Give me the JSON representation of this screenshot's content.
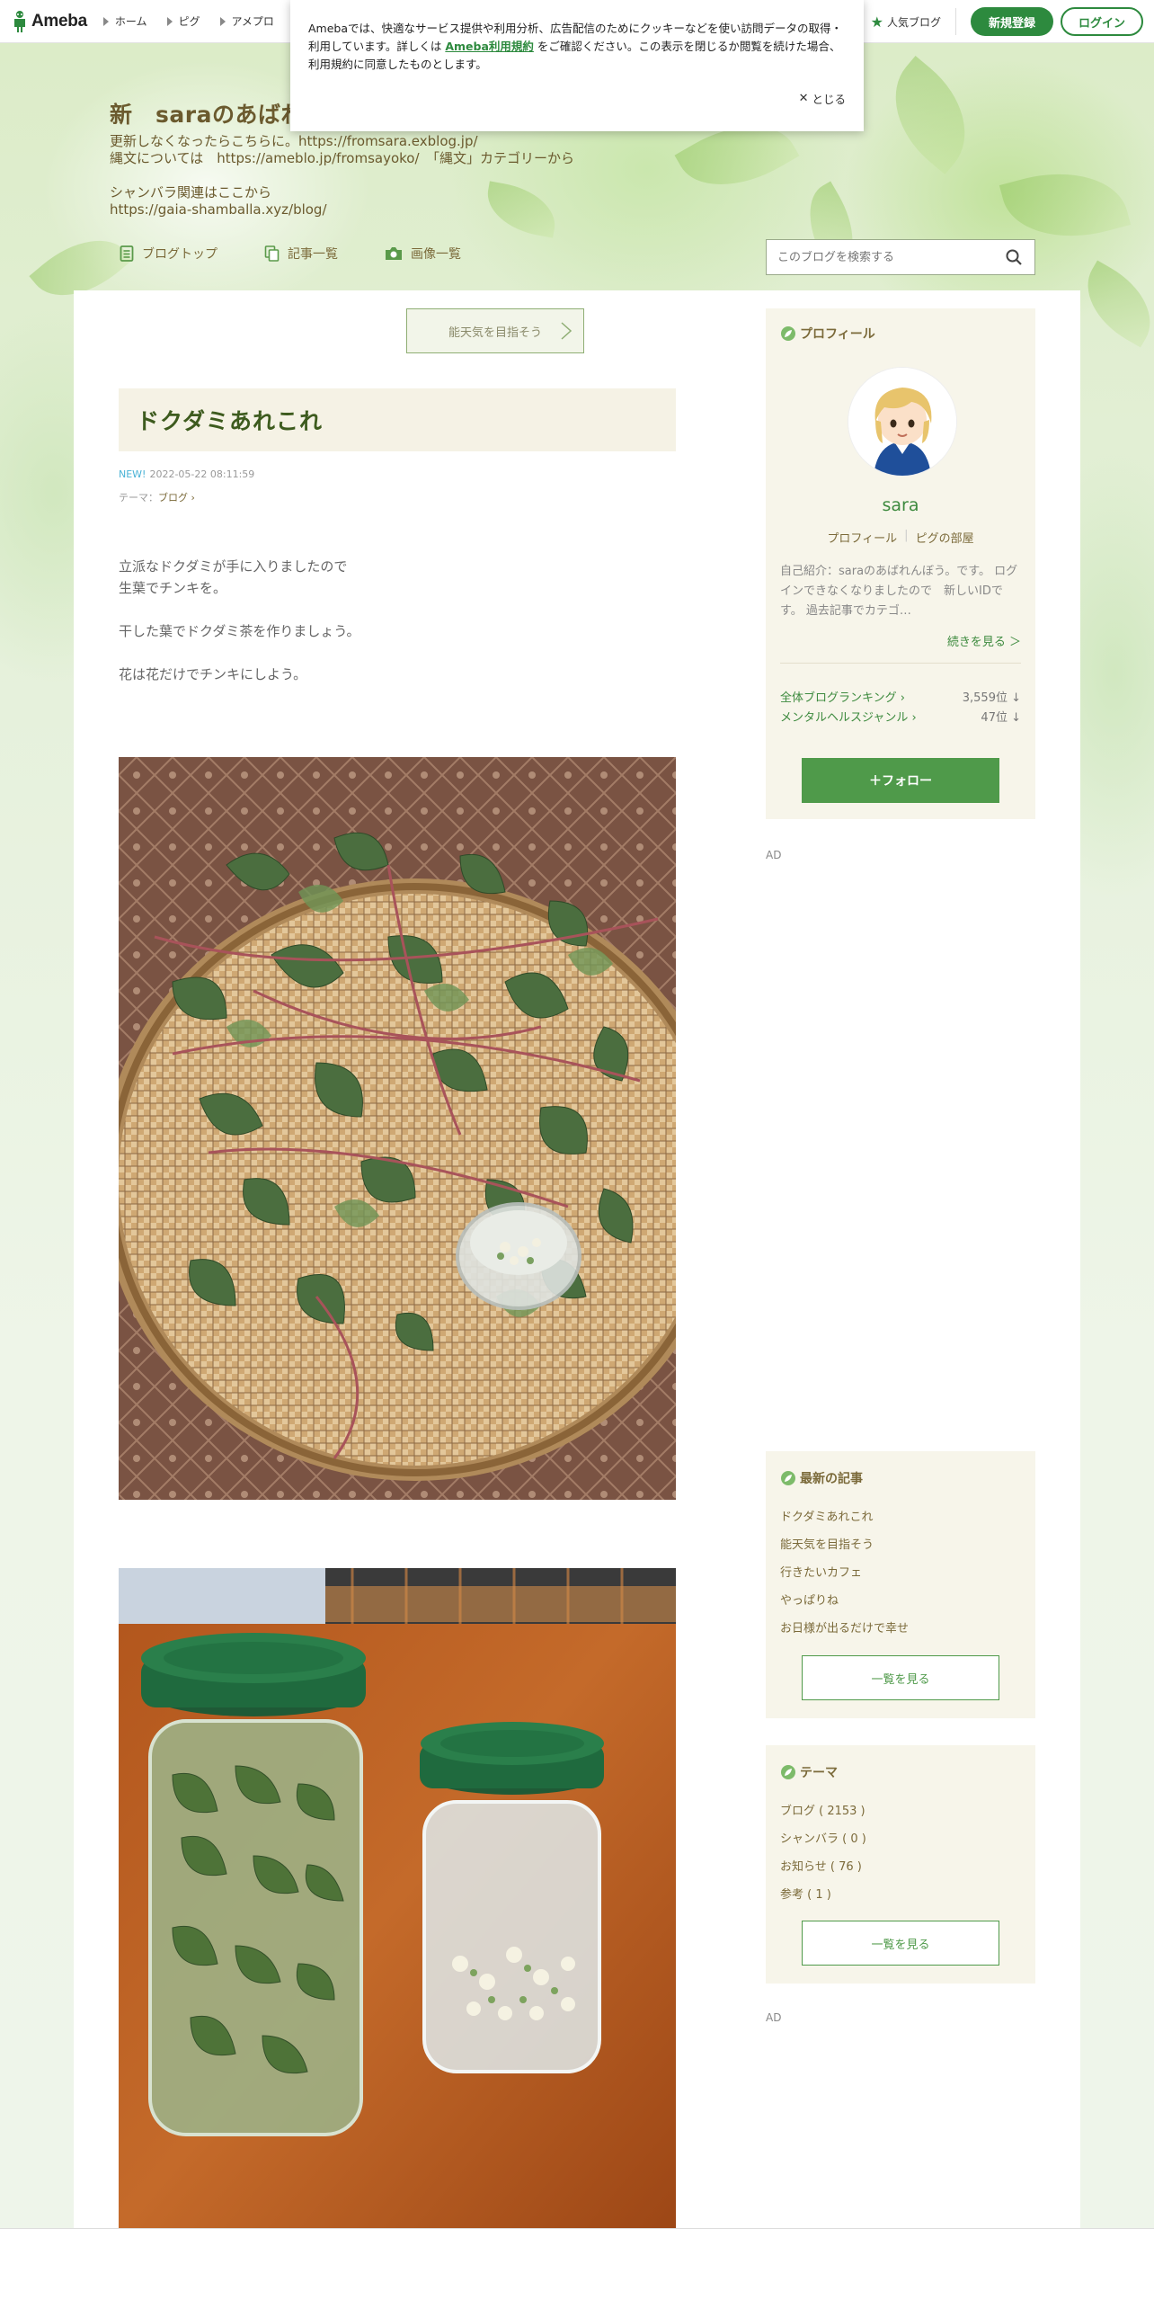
{
  "global_header": {
    "logo_text": "Ameba",
    "nav": [
      "ホーム",
      "ピグ",
      "アメプロ"
    ],
    "popular_blog": "人気ブログ",
    "signup": "新規登録",
    "login": "ログイン"
  },
  "cookie_notice": {
    "text_before": "Amebaでは、快適なサービス提供や利用分析、広告配信のためにクッキーなどを使い訪問データの取得・利用しています。詳しくは ",
    "link": "Ameba利用規約",
    "text_after": " をご確認ください。この表示を閉じるか閲覧を続けた場合、利用規約に同意したものとします。",
    "close": "とじる"
  },
  "blog": {
    "title": "新　saraのあばれんぼう。",
    "description": "更新しなくなったらこちらに。https://fromsara.exblog.jp/\n縄文については　https://ameblo.jp/fromsayoko/　「縄文」カテゴリーから\n\nシャンバラ関連はここから\nhttps://gaia-shamballa.xyz/blog/",
    "nav": {
      "top": "ブログトップ",
      "entries": "記事一覧",
      "images": "画像一覧"
    },
    "search_placeholder": "このブログを検索する"
  },
  "entry": {
    "prev_link": "能天気を目指そう",
    "title": "ドクダミあれこれ",
    "new_badge": "NEW!",
    "datetime": "2022-05-22 08:11:59",
    "theme_label": "テーマ：",
    "theme": "ブログ",
    "body": [
      "立派なドクダミが手に入りましたので",
      "生葉でチンキを。",
      "",
      "干した葉でドクダミ茶を作りましょう。",
      "",
      "花は花だけでチンキにしよう。"
    ]
  },
  "sidebar": {
    "profile": {
      "heading": "プロフィール",
      "name": "sara",
      "link_profile": "プロフィール",
      "link_room": "ピグの部屋",
      "intro": "自己紹介：saraのあばれんぼう。です。 ログインできなくなりましたので　新しいIDです。 過去記事でカテゴ…",
      "more": "続きを見る ＞",
      "rankings": [
        {
          "label": "全体ブログランキング",
          "value": "3,559位 ↓"
        },
        {
          "label": "メンタルヘルスジャンル",
          "value": "47位 ↓"
        }
      ],
      "follow": "フォロー"
    },
    "ad_label": "AD",
    "latest": {
      "heading": "最新の記事",
      "items": [
        "ドクダミあれこれ",
        "能天気を目指そう",
        "行きたいカフェ",
        "やっぱりね",
        "お日様が出るだけで幸せ"
      ],
      "more": "一覧を見る"
    },
    "themes": {
      "heading": "テーマ",
      "items": [
        "ブログ ( 2153 )",
        "シャンバラ ( 0 )",
        "お知らせ ( 76 )",
        "参考 ( 1 )"
      ],
      "more": "一覧を見る"
    }
  },
  "colors": {
    "accent_green": "#2d8a3e",
    "title_brown": "#6b5a2e",
    "sidebar_bg": "#f7f5ea"
  }
}
